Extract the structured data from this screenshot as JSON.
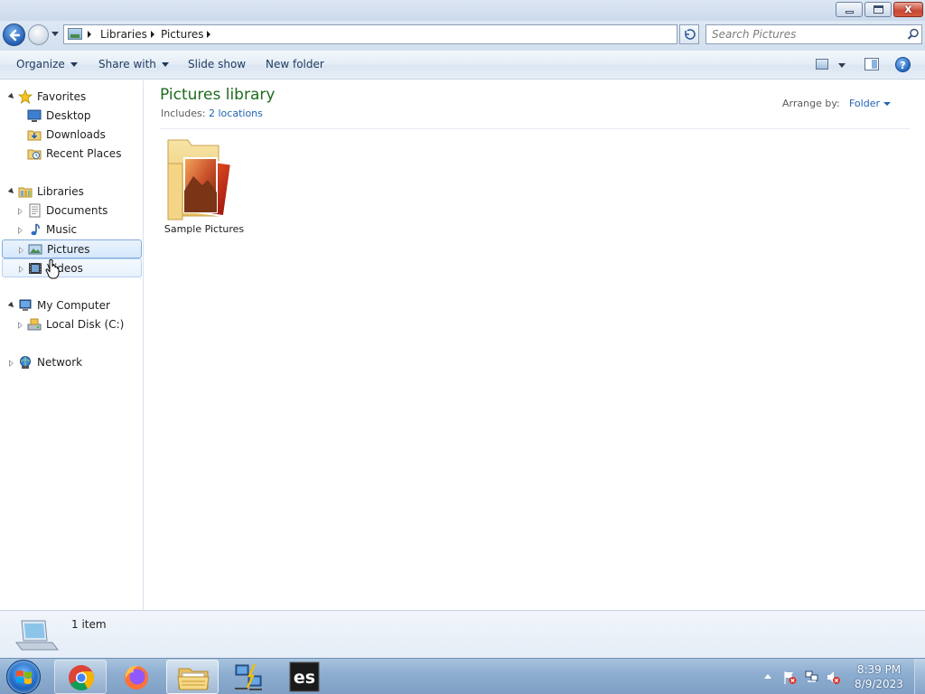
{
  "window": {
    "minimize_icon": "minimize-icon",
    "maximize_icon": "restore-icon",
    "close_label": "x"
  },
  "address_bar": {
    "breadcrumbs": [
      "Libraries",
      "Pictures"
    ],
    "search_placeholder": "Search Pictures"
  },
  "toolbar": {
    "organize": "Organize",
    "share_with": "Share with",
    "slide_show": "Slide show",
    "new_folder": "New folder"
  },
  "nav": {
    "favorites": "Favorites",
    "desktop": "Desktop",
    "downloads": "Downloads",
    "recent_places": "Recent Places",
    "libraries": "Libraries",
    "documents": "Documents",
    "music": "Music",
    "pictures": "Pictures",
    "videos": "Videos",
    "my_computer": "My Computer",
    "local_disk": "Local Disk (C:)",
    "network": "Network",
    "selected": "Pictures"
  },
  "content": {
    "title": "Pictures library",
    "includes_label": "Includes:",
    "includes_link": "2 locations",
    "arrange_label": "Arrange by:",
    "arrange_value": "Folder",
    "items": [
      {
        "name": "Sample Pictures",
        "icon": "folder-pictures-icon"
      }
    ]
  },
  "details": {
    "count": "1 item"
  },
  "taskbar": {
    "apps": [
      "Google Chrome",
      "Firefox",
      "Windows Explorer",
      "Network tool",
      "es"
    ],
    "time": "8:39 PM",
    "date": "8/9/2023"
  },
  "colors": {
    "title_green": "#1e6b1e",
    "link_blue": "#1f63b3",
    "selection_border": "#84acdd"
  }
}
